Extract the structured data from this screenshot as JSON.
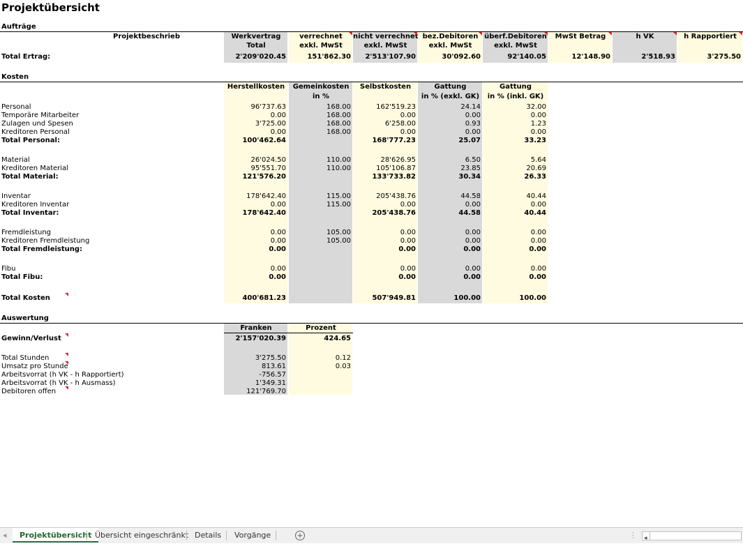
{
  "sheet": {
    "title": "Projektübersicht",
    "auftraege": {
      "section": "Aufträge",
      "headers": [
        {
          "l1": "Projektbeschrieb",
          "l2": ""
        },
        {
          "l1": "Werkvertrag",
          "l2": "Total"
        },
        {
          "l1": "verrechnet",
          "l2": "exkl. MwSt"
        },
        {
          "l1": "nicht verrechnet",
          "l2": "exkl. MwSt"
        },
        {
          "l1": "bez.Debitoren",
          "l2": "exkl. MwSt"
        },
        {
          "l1": "überf.Debitoren",
          "l2": "exkl. MwSt"
        },
        {
          "l1": "MwSt Betrag",
          "l2": ""
        },
        {
          "l1": "h VK",
          "l2": ""
        },
        {
          "l1": "h Rapportiert",
          "l2": ""
        }
      ],
      "total_label": "Total Ertrag:",
      "total_values": [
        "2'209'020.45",
        "151'862.30",
        "2'513'107.90",
        "30'092.60",
        "92'140.05",
        "12'148.90",
        "2'518.93",
        "3'275.50"
      ]
    },
    "kosten": {
      "section": "Kosten",
      "headers": [
        {
          "l1": "Herstellkosten",
          "l2": ""
        },
        {
          "l1": "Gemeinkosten",
          "l2": "in %"
        },
        {
          "l1": "Selbstkosten",
          "l2": ""
        },
        {
          "l1": "Gattung",
          "l2": "in % (exkl. GK)"
        },
        {
          "l1": "Gattung",
          "l2": "in % (inkl. GK)"
        }
      ],
      "rows": [
        {
          "label": "Personal",
          "v": [
            "96'737.63",
            "168.00",
            "162'519.23",
            "24.14",
            "32.00"
          ]
        },
        {
          "label": "Temporäre Mitarbeiter",
          "v": [
            "0.00",
            "168.00",
            "0.00",
            "0.00",
            "0.00"
          ]
        },
        {
          "label": "Zulagen und Spesen",
          "v": [
            "3'725.00",
            "168.00",
            "6'258.00",
            "0.93",
            "1.23"
          ]
        },
        {
          "label": "Kreditoren Personal",
          "v": [
            "0.00",
            "168.00",
            "0.00",
            "0.00",
            "0.00"
          ]
        },
        {
          "label": "Total Personal:",
          "bold": true,
          "v": [
            "100'462.64",
            "",
            "168'777.23",
            "25.07",
            "33.23"
          ]
        },
        {
          "label": "Material",
          "v": [
            "26'024.50",
            "110.00",
            "28'626.95",
            "6.50",
            "5.64"
          ]
        },
        {
          "label": "Kreditoren Material",
          "v": [
            "95'551.70",
            "110.00",
            "105'106.87",
            "23.85",
            "20.69"
          ]
        },
        {
          "label": "Total Material:",
          "bold": true,
          "v": [
            "121'576.20",
            "",
            "133'733.82",
            "30.34",
            "26.33"
          ]
        },
        {
          "label": "Inventar",
          "v": [
            "178'642.40",
            "115.00",
            "205'438.76",
            "44.58",
            "40.44"
          ]
        },
        {
          "label": "Kreditoren Inventar",
          "v": [
            "0.00",
            "115.00",
            "0.00",
            "0.00",
            "0.00"
          ]
        },
        {
          "label": "Total Inventar:",
          "bold": true,
          "v": [
            "178'642.40",
            "",
            "205'438.76",
            "44.58",
            "40.44"
          ]
        },
        {
          "label": "Fremdleistung",
          "v": [
            "0.00",
            "105.00",
            "0.00",
            "0.00",
            "0.00"
          ]
        },
        {
          "label": "Kreditoren Fremdleistung",
          "v": [
            "0.00",
            "105.00",
            "0.00",
            "0.00",
            "0.00"
          ]
        },
        {
          "label": "Total Fremdleistung:",
          "bold": true,
          "v": [
            "0.00",
            "",
            "0.00",
            "0.00",
            "0.00"
          ]
        },
        {
          "label": "Fibu",
          "v": [
            "0.00",
            "",
            "0.00",
            "0.00",
            "0.00"
          ]
        },
        {
          "label": "Total Fibu:",
          "bold": true,
          "v": [
            "0.00",
            "",
            "0.00",
            "0.00",
            "0.00"
          ]
        },
        {
          "label": "Total Kosten",
          "bold": true,
          "v": [
            "400'681.23",
            "",
            "507'949.81",
            "100.00",
            "100.00"
          ]
        }
      ]
    },
    "auswertung": {
      "section": "Auswertung",
      "headers": [
        "Franken",
        "Prozent"
      ],
      "rows": [
        {
          "label": "Gewinn/Verlust",
          "bold": true,
          "franken": "2'157'020.39",
          "prozent": "424.65"
        },
        {
          "label": "Total Stunden",
          "franken": "3'275.50",
          "prozent": "0.12"
        },
        {
          "label": "Umsatz pro Stunde",
          "franken": "813.61",
          "prozent": "0.03"
        },
        {
          "label": "Arbeitsvorrat (h VK - h Rapportiert)",
          "franken": "-756.57",
          "prozent": ""
        },
        {
          "label": "Arbeitsvorrat (h VK - h Ausmass)",
          "franken": "1'349.31",
          "prozent": ""
        },
        {
          "label": "Debitoren offen",
          "franken": "121'769.70",
          "prozent": ""
        }
      ]
    }
  },
  "tabs": [
    "Projektübersicht",
    "Übersicht eingeschränkt",
    "Details",
    "Vorgänge"
  ],
  "active_tab": 0,
  "icons": {
    "add_sheet": "plus-circle-icon",
    "scroll_left": "arrow-left-icon"
  },
  "colors": {
    "gray_fill": "#d9d9d9",
    "yellow_fill": "#fffbe0",
    "comment_marker": "#d32f2f",
    "active_tab": "#217346"
  }
}
